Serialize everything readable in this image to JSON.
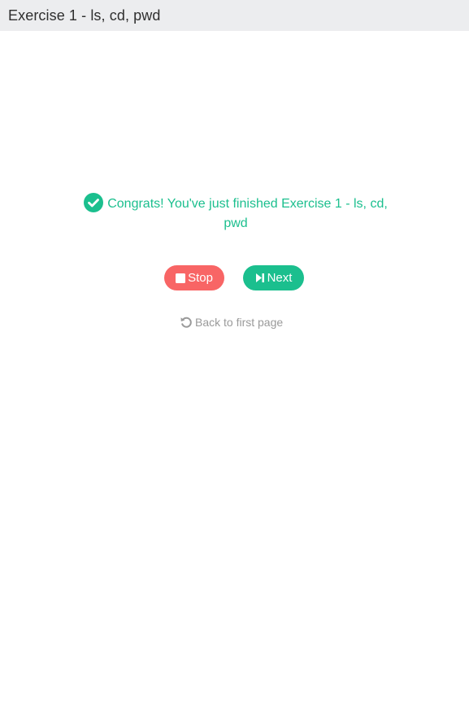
{
  "header": {
    "title": "Exercise 1 - ls, cd, pwd"
  },
  "message": {
    "icon": "check-circle-icon",
    "text": "Congrats! You've just finished Exercise 1 - ls, cd, pwd",
    "color": "#1bbf8e"
  },
  "buttons": {
    "stop": {
      "label": "Stop",
      "icon": "stop-icon",
      "color": "#f86565"
    },
    "next": {
      "label": "Next",
      "icon": "step-forward-icon",
      "color": "#1bbf8e"
    }
  },
  "back_link": {
    "label": "Back to first page",
    "icon": "undo-icon"
  }
}
